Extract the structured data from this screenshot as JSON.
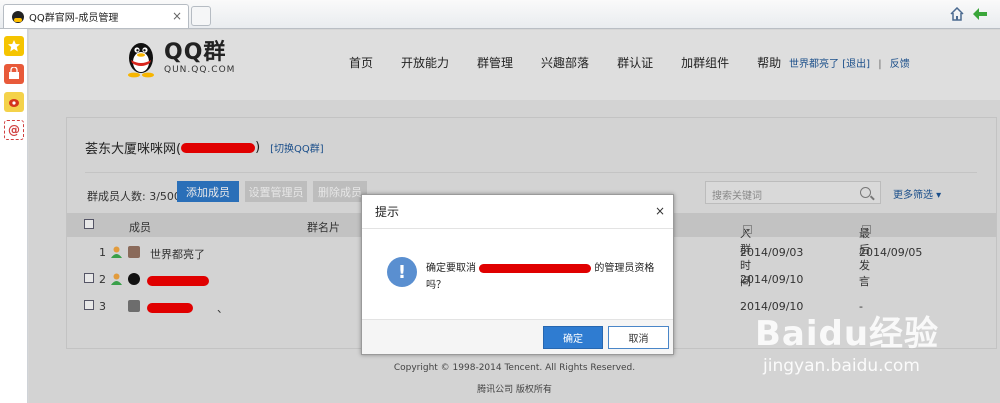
{
  "browser": {
    "tab_title": "QQ群官网-成员管理",
    "tab_close": "×"
  },
  "header": {
    "logo_main": "QQ群",
    "logo_sub": "QUN.QQ.COM",
    "nav": [
      "首页",
      "开放能力",
      "群管理",
      "兴趣部落",
      "群认证",
      "加群组件",
      "帮助"
    ],
    "user_name": "世界都亮了",
    "logout": "[退出]",
    "feedback": "反馈"
  },
  "group": {
    "name_prefix": "荟东大厦咪咪网(",
    "name_suffix": ")",
    "switch_link": "[切换QQ群]"
  },
  "toolbar": {
    "member_count": "群成员人数: 3/500",
    "add_member": "添加成员",
    "set_admin": "设置管理员",
    "remove_member": "删除成员",
    "search_placeholder": "搜索关键词",
    "more_filter": "更多筛选 ▾"
  },
  "table": {
    "headers": {
      "member": "成员",
      "group_card": "群名片",
      "join_time": "入群时间",
      "last_speak": "最后发言"
    },
    "rows": [
      {
        "index": "1",
        "name": "世界都亮了",
        "join_time": "2014/09/03",
        "last_speak": "2014/09/05"
      },
      {
        "index": "2",
        "name": "",
        "join_time": "2014/09/10",
        "last_speak": "-"
      },
      {
        "index": "3",
        "name": "、",
        "join_time": "2014/09/10",
        "last_speak": "-"
      }
    ]
  },
  "footer": {
    "copyright": "Copyright © 1998-2014 Tencent. All Rights Reserved.",
    "company": "腾讯公司 版权所有"
  },
  "dialog": {
    "title": "提示",
    "close": "×",
    "icon": "!",
    "message_prefix": "确定要取消",
    "message_suffix": "的管理员资格吗？",
    "ok": "确定",
    "cancel": "取消"
  },
  "watermark": {
    "brand": "Baidu经验",
    "url": "jingyan.baidu.com"
  },
  "colors": {
    "accent": "#2f7cd1",
    "redaction": "#e00000",
    "link": "#1a4e8a"
  }
}
